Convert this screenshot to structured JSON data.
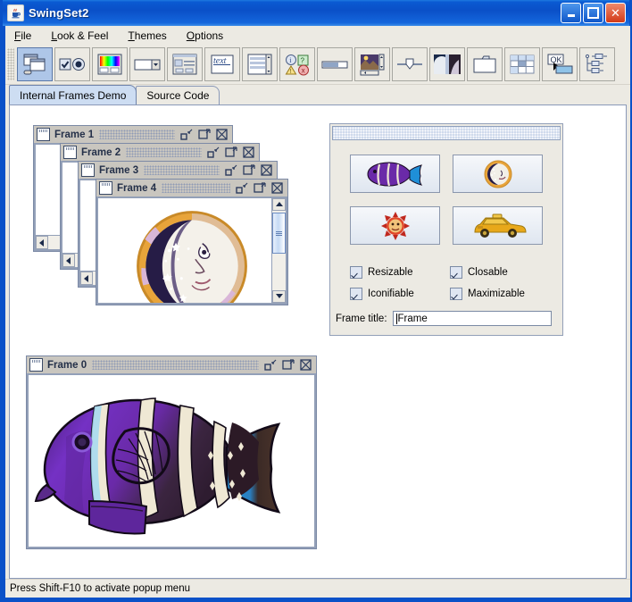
{
  "window": {
    "title": "SwingSet2",
    "app_icon": "java-cup-icon",
    "buttons": [
      {
        "name": "minimize-button",
        "glyph": "_"
      },
      {
        "name": "maximize-button",
        "glyph": "□"
      },
      {
        "name": "close-button",
        "glyph": "✕"
      }
    ]
  },
  "menubar": {
    "items": [
      {
        "label": "File",
        "mnemonic": "F"
      },
      {
        "label": "Look & Feel",
        "mnemonic": "L"
      },
      {
        "label": "Themes",
        "mnemonic": "T"
      },
      {
        "label": "Options",
        "mnemonic": "O"
      }
    ]
  },
  "toolbar": {
    "buttons": [
      {
        "name": "internal-frames-demo-button",
        "icon": "windows-icon",
        "selected": true
      },
      {
        "name": "button-demo-button",
        "icon": "checkbox-radio-icon",
        "selected": false
      },
      {
        "name": "colorchooser-demo-button",
        "icon": "color-palette-icon",
        "selected": false
      },
      {
        "name": "combobox-demo-button",
        "icon": "combobox-icon",
        "selected": false
      },
      {
        "name": "filechooser-demo-button",
        "icon": "filechooser-icon",
        "selected": false
      },
      {
        "name": "html-demo-button",
        "icon": "text-icon",
        "selected": false
      },
      {
        "name": "list-demo-button",
        "icon": "list-icon",
        "selected": false
      },
      {
        "name": "optionpane-demo-button",
        "icon": "optionpane-icon",
        "selected": false
      },
      {
        "name": "progressbar-demo-button",
        "icon": "progressbar-icon",
        "selected": false
      },
      {
        "name": "scrollpane-demo-button",
        "icon": "scrollpane-icon",
        "selected": false
      },
      {
        "name": "slider-demo-button",
        "icon": "slider-icon",
        "selected": false
      },
      {
        "name": "splitpane-demo-button",
        "icon": "splitpane-icon",
        "selected": false
      },
      {
        "name": "tabbedpane-demo-button",
        "icon": "tabbedpane-icon",
        "selected": false
      },
      {
        "name": "table-demo-button",
        "icon": "table-icon",
        "selected": false
      },
      {
        "name": "tooltip-demo-button",
        "icon": "tooltip-ok-icon",
        "selected": false
      },
      {
        "name": "tree-demo-button",
        "icon": "tree-icon",
        "selected": false
      }
    ]
  },
  "tabs": [
    {
      "label": "Internal Frames Demo",
      "active": true
    },
    {
      "label": "Source Code",
      "active": false
    }
  ],
  "desktop": {
    "frames": [
      {
        "title": "Frame 1",
        "image": "none"
      },
      {
        "title": "Frame 2",
        "image": "none"
      },
      {
        "title": "Frame 3",
        "image": "none"
      },
      {
        "title": "Frame 4",
        "image": "moon-picture"
      },
      {
        "title": "Frame 0",
        "image": "fish-picture"
      }
    ],
    "frame_window_buttons": [
      {
        "name": "iconify-button",
        "icon": "iconify-icon"
      },
      {
        "name": "maximize-button",
        "icon": "maximize-icon"
      },
      {
        "name": "close-button",
        "icon": "close-icon"
      }
    ]
  },
  "palette": {
    "title_bar": "palette-title-bar",
    "image_buttons": [
      {
        "name": "fish-image-button",
        "icon": "fish-icon"
      },
      {
        "name": "moon-image-button",
        "icon": "moon-icon"
      },
      {
        "name": "sun-image-button",
        "icon": "sun-icon"
      },
      {
        "name": "cab-image-button",
        "icon": "cab-icon"
      }
    ],
    "checkboxes": [
      {
        "label": "Resizable",
        "checked": true
      },
      {
        "label": "Closable",
        "checked": true
      },
      {
        "label": "Iconifiable",
        "checked": true
      },
      {
        "label": "Maximizable",
        "checked": true
      }
    ],
    "frame_title_label": "Frame title:",
    "frame_title_value": "Frame"
  },
  "status": {
    "text": "Press Shift-F10 to activate popup menu"
  },
  "colors": {
    "titlebar_blue": "#0a51c8",
    "tab_active": "#cdddf2",
    "toolbar_selected": "#aec6e8",
    "panel_bg": "#eceae3",
    "frame_bar": "#c9c6bf",
    "fish_purple": "#6a2fa8",
    "fish_tail_blue": "#1f8fd8",
    "cab_yellow": "#e8a81a",
    "moon_navy": "#221a3e"
  }
}
